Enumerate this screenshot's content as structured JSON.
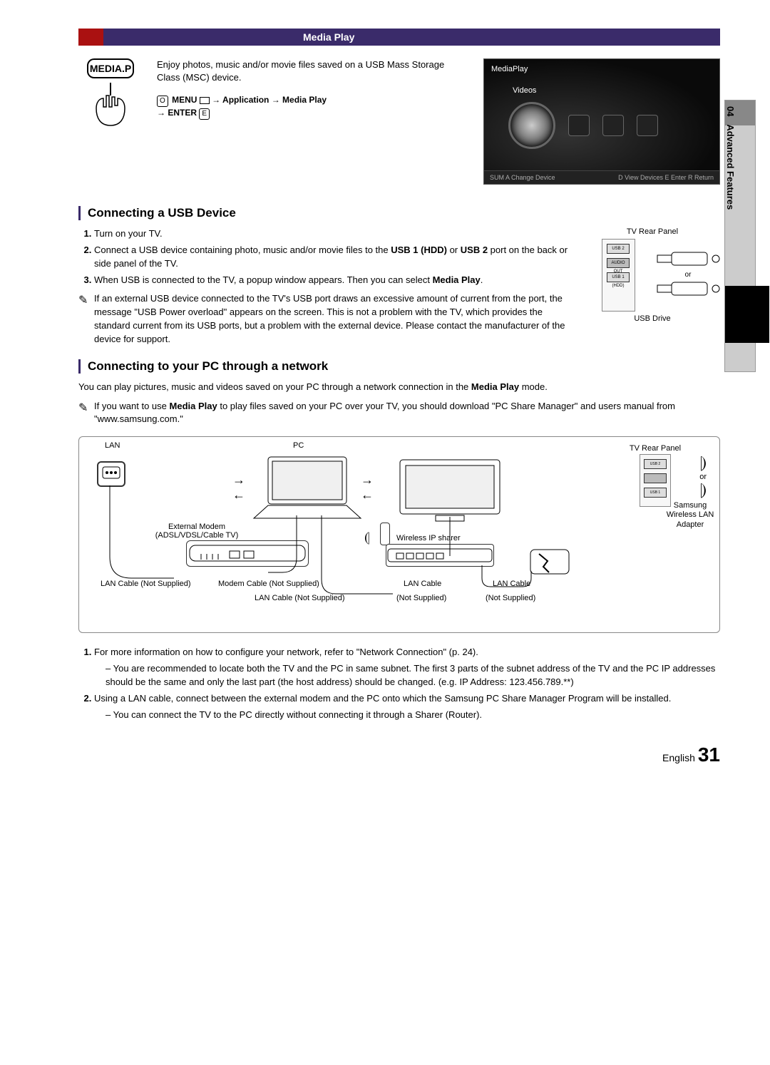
{
  "sidebar": {
    "chapter": "04",
    "label": "Advanced Features"
  },
  "titlebar": {
    "title": "Media Play"
  },
  "mediaplay": {
    "button": "MEDIA.P",
    "desc": "Enjoy photos, music and/or movie files saved on a USB Mass Storage Class (MSC) device.",
    "nav_icon": "O",
    "nav_menu": "MENU",
    "nav_path": " → Application → Media Play",
    "nav_enter": "→ ENTER",
    "enter_icon": "E"
  },
  "tvshot": {
    "title": "MediaPlay",
    "videos": "Videos",
    "footer_left": "SUM    A Change Device",
    "footer_right": "D View Devices     E Enter     R Return"
  },
  "usb": {
    "heading": "Connecting a USB Device",
    "steps": [
      "Turn on your TV.",
      "Connect a USB device containing photo, music and/or movie files to the USB 1 (HDD) or USB 2 port on the back or side panel of the TV.",
      "When USB is connected to the TV, a popup window appears. Then you can select Media Play."
    ],
    "step2_bold_a": "USB 1 (HDD)",
    "step2_bold_b": "USB 2",
    "step3_bold": "Media Play",
    "note": "If an external USB device connected to the TV's USB port draws an excessive amount of current from the port, the message \"USB Power overload\" appears on the screen. This is not a problem with the TV, which provides the standard current from its USB ports, but a problem with the external device. Please contact the manufacturer of the device for support.",
    "fig": {
      "label_top": "TV Rear Panel",
      "usb2": "USB 2",
      "audio": "AUDIO OUT",
      "usb1": "USB 1 (HDD)",
      "or": "or",
      "drive": "USB Drive"
    }
  },
  "network": {
    "heading": "Connecting to your PC through a network",
    "intro_a": "You can play pictures, music and videos saved on your PC through a network connection in the ",
    "intro_bold": "Media Play",
    "intro_b": " mode.",
    "note_a": "If you want to use ",
    "note_bold": "Media Play",
    "note_b": " to play files saved on your PC over your TV, you should download \"PC Share Manager\" and users manual from \"www.samsung.com.\"",
    "fig": {
      "lan": "LAN",
      "pc": "PC",
      "tv_rear": "TV Rear Panel",
      "or": "or",
      "adapter": "Samsung Wireless LAN Adapter",
      "modem": "External Modem",
      "modem_sub": "(ADSL/VDSL/Cable TV)",
      "sharer": "Wireless IP sharer",
      "lan_cable_ns": "LAN Cable (Not Supplied)",
      "modem_cable_ns": "Modem Cable (Not Supplied)",
      "lan_cable": "LAN Cable",
      "not_supplied": "(Not Supplied)"
    },
    "steps": {
      "s1": "For more information on how to configure your network, refer to \"Network Connection\" (p. 24).",
      "s1_sub": "You are recommended to locate both the TV and the PC in same subnet. The first 3 parts of the subnet address of the TV and the PC IP addresses should be the same and only the last part (the host address) should be changed. (e.g. IP Address: 123.456.789.**)",
      "s2": "Using a LAN cable, connect between the external modem and the PC onto which the Samsung PC Share Manager Program will be installed.",
      "s2_sub": "You can connect the TV to the PC directly without connecting it through a Sharer (Router)."
    }
  },
  "footer": {
    "lang": "English",
    "page": "31"
  }
}
